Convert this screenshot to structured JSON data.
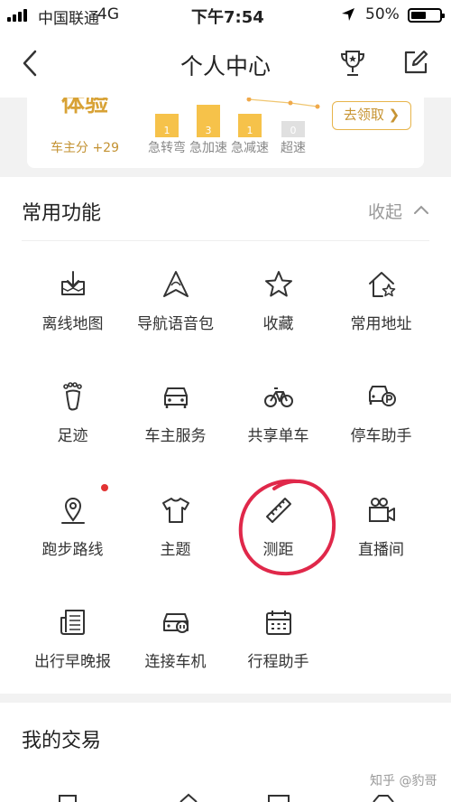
{
  "status_bar": {
    "carrier": "中国联通",
    "network": "4G",
    "time": "下午7:54",
    "battery_percent": "50%"
  },
  "nav_bar": {
    "title": "个人中心",
    "back_icon": "chevron-left-icon",
    "trophy_icon": "trophy-icon",
    "edit_icon": "edit-icon"
  },
  "score_card": {
    "rank_partial": "体验",
    "driver_score": "车主分 +29",
    "claim_label": "去领取",
    "bars": [
      {
        "label": "急转弯",
        "value": "1"
      },
      {
        "label": "急加速",
        "value": "3"
      },
      {
        "label": "急减速",
        "value": "1"
      },
      {
        "label": "超速",
        "value": "0"
      }
    ]
  },
  "functions": {
    "title": "常用功能",
    "collapse_label": "收起",
    "items": [
      {
        "label": "离线地图",
        "icon": "download-map-icon"
      },
      {
        "label": "导航语音包",
        "icon": "navigation-voice-icon"
      },
      {
        "label": "收藏",
        "icon": "star-icon"
      },
      {
        "label": "常用地址",
        "icon": "home-star-icon"
      },
      {
        "label": "足迹",
        "icon": "footprint-icon"
      },
      {
        "label": "车主服务",
        "icon": "car-icon"
      },
      {
        "label": "共享单车",
        "icon": "bicycle-icon"
      },
      {
        "label": "停车助手",
        "icon": "parking-icon"
      },
      {
        "label": "跑步路线",
        "icon": "location-pin-icon"
      },
      {
        "label": "主题",
        "icon": "tshirt-icon"
      },
      {
        "label": "测距",
        "icon": "ruler-icon"
      },
      {
        "label": "直播间",
        "icon": "video-camera-icon"
      },
      {
        "label": "出行早晚报",
        "icon": "newspaper-icon"
      },
      {
        "label": "连接车机",
        "icon": "car-connect-icon"
      },
      {
        "label": "行程助手",
        "icon": "calendar-icon"
      }
    ]
  },
  "trade": {
    "title": "我的交易",
    "watermark": "知乎 @豹哥"
  },
  "colors": {
    "accent_gold": "#d8a235",
    "bar_yellow": "#f6c24a",
    "annotation_red": "#e0284a",
    "notification_dot": "#e23333"
  }
}
